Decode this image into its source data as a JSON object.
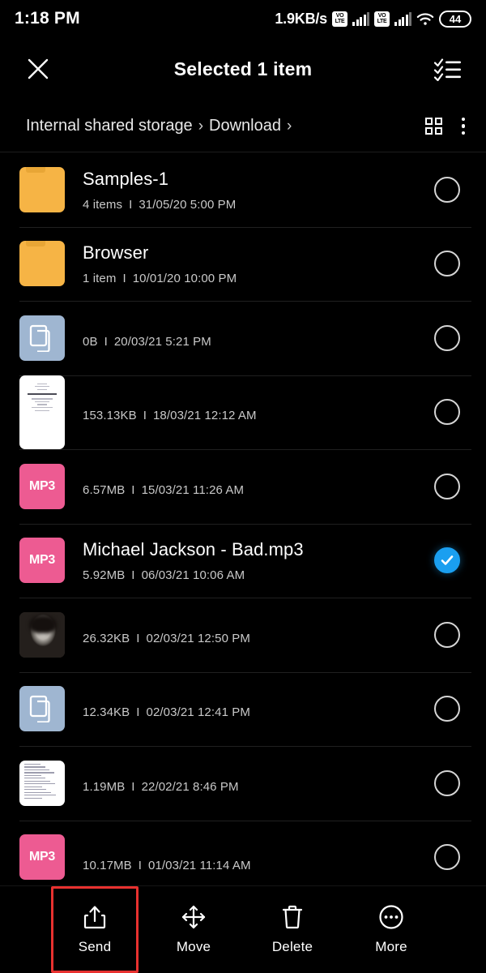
{
  "status_bar": {
    "time": "1:18 PM",
    "net_speed": "1.9KB/s",
    "volte_top": "VO",
    "volte_bottom": "LTE",
    "battery_level": "44",
    "icons": [
      "volte-icon",
      "signal-bars-icon",
      "volte-icon",
      "signal-bars-icon",
      "wifi-icon",
      "battery-icon"
    ]
  },
  "app_bar": {
    "close_label": "✕",
    "title": "Selected 1 item",
    "select_all_icon": "select-all-icon"
  },
  "breadcrumb": {
    "items": [
      "Internal shared storage",
      "Download"
    ],
    "separator": "›",
    "trailing_separator": "›",
    "grid_view_icon": "grid-view-icon",
    "overflow_icon": "overflow-menu-icon"
  },
  "colors": {
    "background": "#000000",
    "folder": "#f6b445",
    "mp3": "#ed5b92",
    "doc": "#9fb6d1",
    "selected_check": "#1a9ff0",
    "highlight_box": "#e8312f",
    "divider": "#202020"
  },
  "files": [
    {
      "name": "Samples-1",
      "redacted": false,
      "icon": "folder-icon",
      "icon_type": "folder",
      "icon_label": "",
      "size": "4 items",
      "date": "31/05/20 5:00 PM",
      "selected": false
    },
    {
      "name": "Browser",
      "redacted": false,
      "icon": "folder-icon",
      "icon_type": "folder",
      "icon_label": "",
      "size": "1 item",
      "date": "10/01/20 10:00 PM",
      "selected": false
    },
    {
      "name": "",
      "redacted": true,
      "icon": "document-icon",
      "icon_type": "doc",
      "icon_label": "",
      "size": "0B",
      "date": "20/03/21 5:21 PM",
      "selected": false
    },
    {
      "name": "",
      "redacted": true,
      "icon": "certificate-thumbnail",
      "icon_type": "cert",
      "icon_label": "",
      "size": "153.13KB",
      "date": "18/03/21 12:12 AM",
      "selected": false
    },
    {
      "name": "",
      "redacted": true,
      "icon": "mp3-icon",
      "icon_type": "mp3",
      "icon_label": "MP3",
      "size": "6.57MB",
      "date": "15/03/21 11:26 AM",
      "selected": false
    },
    {
      "name": "Michael Jackson - Bad.mp3",
      "redacted": false,
      "icon": "mp3-icon",
      "icon_type": "mp3",
      "icon_label": "MP3",
      "size": "5.92MB",
      "date": "06/03/21 10:06 AM",
      "selected": true
    },
    {
      "name": "",
      "redacted": true,
      "icon": "photo-thumbnail",
      "icon_type": "image",
      "icon_label": "",
      "size": "26.32KB",
      "date": "02/03/21 12:50 PM",
      "selected": false
    },
    {
      "name": "",
      "redacted": true,
      "icon": "document-icon",
      "icon_type": "doc",
      "icon_label": "",
      "size": "12.34KB",
      "date": "02/03/21 12:41 PM",
      "selected": false
    },
    {
      "name": "",
      "redacted": true,
      "icon": "spreadsheet-thumbnail",
      "icon_type": "sheet",
      "icon_label": "",
      "size": "1.19MB",
      "date": "22/02/21 8:46 PM",
      "selected": false
    },
    {
      "name": "",
      "redacted": true,
      "icon": "mp3-icon",
      "icon_type": "mp3",
      "icon_label": "MP3",
      "size": "10.17MB",
      "date": "01/03/21 11:14 AM",
      "selected": false
    }
  ],
  "separator": "I",
  "toolbar": {
    "items": [
      {
        "label": "Send",
        "icon": "share-icon",
        "highlighted": true
      },
      {
        "label": "Move",
        "icon": "move-icon",
        "highlighted": false
      },
      {
        "label": "Delete",
        "icon": "trash-icon",
        "highlighted": false
      },
      {
        "label": "More",
        "icon": "more-circle-icon",
        "highlighted": false
      }
    ]
  }
}
